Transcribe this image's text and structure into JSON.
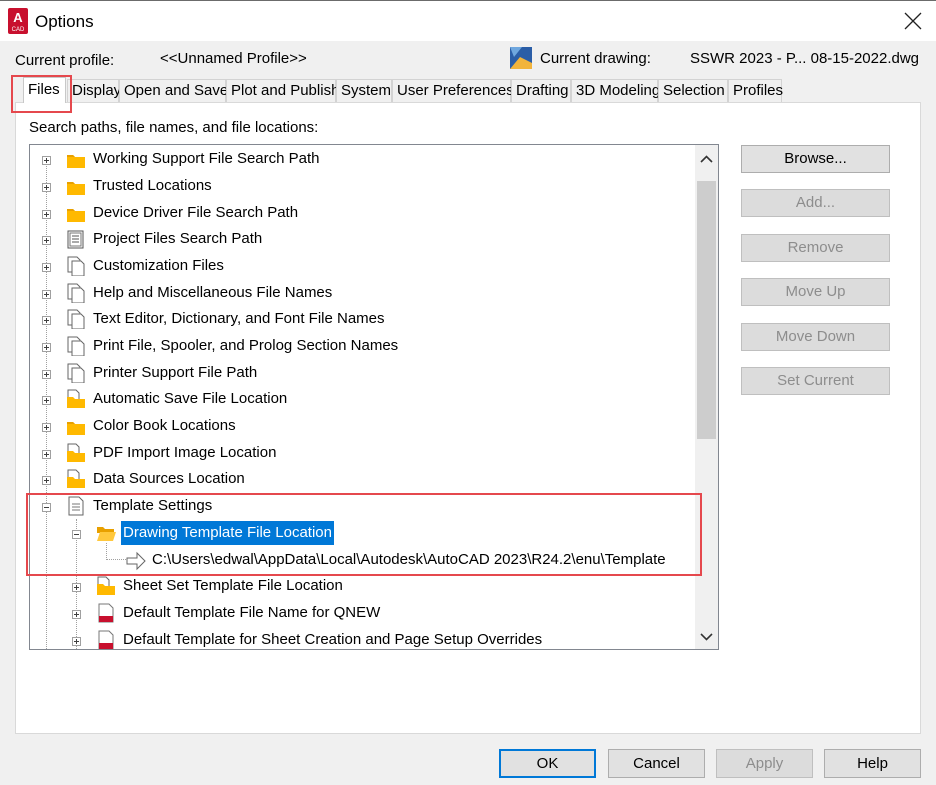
{
  "window": {
    "title": "Options",
    "app_icon_text": "A",
    "app_icon_sub": "CAD"
  },
  "profile": {
    "current_profile_label": "Current profile:",
    "current_profile_value": "<<Unnamed Profile>>",
    "current_drawing_label": "Current drawing:",
    "current_drawing_value": "SSWR 2023 - P... 08-15-2022.dwg"
  },
  "tabs": [
    {
      "label": "Files",
      "active": true
    },
    {
      "label": "Display"
    },
    {
      "label": "Open and Save"
    },
    {
      "label": "Plot and Publish"
    },
    {
      "label": "System"
    },
    {
      "label": "User Preferences"
    },
    {
      "label": "Drafting"
    },
    {
      "label": "3D Modeling"
    },
    {
      "label": "Selection"
    },
    {
      "label": "Profiles"
    }
  ],
  "files": {
    "search_label": "Search paths, file names, and file locations:",
    "tree": [
      {
        "label": "Working Support File Search Path",
        "icon": "folder-icon"
      },
      {
        "label": "Trusted Locations",
        "icon": "folder-icon"
      },
      {
        "label": "Device Driver File Search Path",
        "icon": "folder-icon"
      },
      {
        "label": "Project Files Search Path",
        "icon": "project-icon"
      },
      {
        "label": "Customization Files",
        "icon": "files-icon"
      },
      {
        "label": "Help and Miscellaneous File Names",
        "icon": "files-icon"
      },
      {
        "label": "Text Editor, Dictionary, and Font File Names",
        "icon": "files-icon"
      },
      {
        "label": "Print File, Spooler, and Prolog Section Names",
        "icon": "files-icon"
      },
      {
        "label": "Printer Support File Path",
        "icon": "files-icon"
      },
      {
        "label": "Automatic Save File Location",
        "icon": "folder-file-icon"
      },
      {
        "label": "Color Book Locations",
        "icon": "folder-icon"
      },
      {
        "label": "PDF Import Image Location",
        "icon": "folder-file-icon"
      },
      {
        "label": "Data Sources Location",
        "icon": "folder-file-icon"
      },
      {
        "label": "Template Settings",
        "icon": "document-icon"
      },
      {
        "label": "Drawing Template File Location",
        "icon": "open-folder-icon"
      },
      {
        "label": "C:\\Users\\edwal\\AppData\\Local\\Autodesk\\AutoCAD 2023\\R24.2\\enu\\Template",
        "icon": "arrow-right-icon"
      },
      {
        "label": "Sheet Set Template File Location",
        "icon": "folder-file-icon"
      },
      {
        "label": "Default Template File Name for QNEW",
        "icon": "dwt-file-icon"
      },
      {
        "label": "Default Template for Sheet Creation and Page Setup Overrides",
        "icon": "dwt-file-icon"
      }
    ]
  },
  "side_buttons": {
    "browse": "Browse...",
    "add": "Add...",
    "remove": "Remove",
    "move_up": "Move Up",
    "move_down": "Move Down",
    "set_current": "Set Current"
  },
  "footer": {
    "ok": "OK",
    "cancel": "Cancel",
    "apply": "Apply",
    "help": "Help"
  },
  "colors": {
    "selection": "#0078d7",
    "highlight_box": "#e5484d",
    "folder": "#ffb900"
  }
}
